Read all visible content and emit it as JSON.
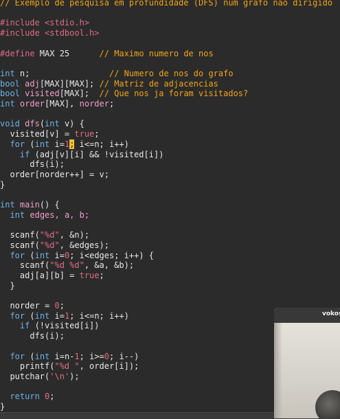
{
  "editor": {
    "lines": [
      [
        {
          "t": "// Exemplo de pesquisa em profundidade (DFS) num grafo nao dirigido",
          "c": "comment"
        }
      ],
      [],
      [
        {
          "t": "#include ",
          "c": "pre"
        },
        {
          "t": "<stdio.h>",
          "c": "inc"
        }
      ],
      [
        {
          "t": "#include ",
          "c": "pre"
        },
        {
          "t": "<stdbool.h>",
          "c": "inc"
        }
      ],
      [],
      [
        {
          "t": "#define ",
          "c": "pre"
        },
        {
          "t": "MAX 25",
          "c": "plain"
        },
        {
          "t": "      ",
          "c": "plain"
        },
        {
          "t": "// Maximo numero de nos",
          "c": "comment"
        }
      ],
      [],
      [
        {
          "t": "int",
          "c": "type"
        },
        {
          "t": " n;",
          "c": "plain"
        },
        {
          "t": "                ",
          "c": "plain"
        },
        {
          "t": "// Numero de nos do grafo",
          "c": "comment"
        }
      ],
      [
        {
          "t": "bool",
          "c": "type"
        },
        {
          "t": " adj",
          "c": "var"
        },
        {
          "t": "[MAX][MAX]; ",
          "c": "plain"
        },
        {
          "t": "// Matriz de adjacencias",
          "c": "comment"
        }
      ],
      [
        {
          "t": "bool",
          "c": "type"
        },
        {
          "t": " visited",
          "c": "var"
        },
        {
          "t": "[MAX];  ",
          "c": "plain"
        },
        {
          "t": "// Que nos ja foram visitados?",
          "c": "comment"
        }
      ],
      [
        {
          "t": "int",
          "c": "type"
        },
        {
          "t": " order",
          "c": "var"
        },
        {
          "t": "[MAX], ",
          "c": "plain"
        },
        {
          "t": "norder",
          "c": "var"
        },
        {
          "t": ";",
          "c": "plain"
        }
      ],
      [],
      [
        {
          "t": "void",
          "c": "type"
        },
        {
          "t": " dfs",
          "c": "fn"
        },
        {
          "t": "(",
          "c": "plain"
        },
        {
          "t": "int",
          "c": "type"
        },
        {
          "t": " v) {",
          "c": "plain"
        }
      ],
      [
        {
          "t": "  visited[v] = ",
          "c": "plain"
        },
        {
          "t": "true",
          "c": "const"
        },
        {
          "t": ";",
          "c": "plain"
        }
      ],
      [
        {
          "t": "  ",
          "c": "plain"
        },
        {
          "t": "for",
          "c": "kw"
        },
        {
          "t": " (",
          "c": "plain"
        },
        {
          "t": "int",
          "c": "type"
        },
        {
          "t": " i=",
          "c": "plain"
        },
        {
          "t": "1",
          "c": "num"
        },
        {
          "t": ";",
          "c": "cursor"
        },
        {
          "t": " i<=n; i++)",
          "c": "plain"
        }
      ],
      [
        {
          "t": "    ",
          "c": "plain"
        },
        {
          "t": "if",
          "c": "kw"
        },
        {
          "t": " (adj[v][i] && !visited[i])",
          "c": "plain"
        }
      ],
      [
        {
          "t": "      dfs(i);",
          "c": "plain"
        }
      ],
      [
        {
          "t": "  order[norder++] = v;",
          "c": "plain"
        }
      ],
      [
        {
          "t": "}",
          "c": "plain"
        }
      ],
      [],
      [
        {
          "t": "int",
          "c": "type"
        },
        {
          "t": " main",
          "c": "fn"
        },
        {
          "t": "() {",
          "c": "plain"
        }
      ],
      [
        {
          "t": "  ",
          "c": "plain"
        },
        {
          "t": "int",
          "c": "type"
        },
        {
          "t": " edges, a, b;",
          "c": "var"
        }
      ],
      [],
      [
        {
          "t": "  scanf(",
          "c": "plain"
        },
        {
          "t": "\"%d\"",
          "c": "str"
        },
        {
          "t": ", &n);",
          "c": "plain"
        }
      ],
      [
        {
          "t": "  scanf(",
          "c": "plain"
        },
        {
          "t": "\"%d\"",
          "c": "str"
        },
        {
          "t": ", &edges);",
          "c": "plain"
        }
      ],
      [
        {
          "t": "  ",
          "c": "plain"
        },
        {
          "t": "for",
          "c": "kw"
        },
        {
          "t": " (",
          "c": "plain"
        },
        {
          "t": "int",
          "c": "type"
        },
        {
          "t": " i=",
          "c": "plain"
        },
        {
          "t": "0",
          "c": "num"
        },
        {
          "t": "; i<edges; i++) {",
          "c": "plain"
        }
      ],
      [
        {
          "t": "    scanf(",
          "c": "plain"
        },
        {
          "t": "\"%d %d\"",
          "c": "str"
        },
        {
          "t": ", &a, &b);",
          "c": "plain"
        }
      ],
      [
        {
          "t": "    adj[a][b] = ",
          "c": "plain"
        },
        {
          "t": "true",
          "c": "const"
        },
        {
          "t": ";",
          "c": "plain"
        }
      ],
      [
        {
          "t": "  }",
          "c": "plain"
        }
      ],
      [],
      [
        {
          "t": "  norder = ",
          "c": "plain"
        },
        {
          "t": "0",
          "c": "num"
        },
        {
          "t": ";",
          "c": "plain"
        }
      ],
      [
        {
          "t": "  ",
          "c": "plain"
        },
        {
          "t": "for",
          "c": "kw"
        },
        {
          "t": " (",
          "c": "plain"
        },
        {
          "t": "int",
          "c": "type"
        },
        {
          "t": " i=",
          "c": "plain"
        },
        {
          "t": "1",
          "c": "num"
        },
        {
          "t": "; i<=n; i++)",
          "c": "plain"
        }
      ],
      [
        {
          "t": "    ",
          "c": "plain"
        },
        {
          "t": "if",
          "c": "kw"
        },
        {
          "t": " (!visited[i])",
          "c": "plain"
        }
      ],
      [
        {
          "t": "      dfs(i);",
          "c": "plain"
        }
      ],
      [],
      [
        {
          "t": "  ",
          "c": "plain"
        },
        {
          "t": "for",
          "c": "kw"
        },
        {
          "t": " (",
          "c": "plain"
        },
        {
          "t": "int",
          "c": "type"
        },
        {
          "t": " i=n-",
          "c": "plain"
        },
        {
          "t": "1",
          "c": "num"
        },
        {
          "t": "; i>=",
          "c": "plain"
        },
        {
          "t": "0",
          "c": "num"
        },
        {
          "t": "; i--)",
          "c": "plain"
        }
      ],
      [
        {
          "t": "    printf(",
          "c": "plain"
        },
        {
          "t": "\"%d \"",
          "c": "str"
        },
        {
          "t": ", order[i]);",
          "c": "plain"
        }
      ],
      [
        {
          "t": "  putchar(",
          "c": "plain"
        },
        {
          "t": "'\\n'",
          "c": "str"
        },
        {
          "t": ");",
          "c": "plain"
        }
      ],
      [],
      [
        {
          "t": "  ",
          "c": "plain"
        },
        {
          "t": "return",
          "c": "kw"
        },
        {
          "t": " ",
          "c": "plain"
        },
        {
          "t": "0",
          "c": "num"
        },
        {
          "t": ";",
          "c": "plain"
        }
      ],
      [
        {
          "t": "}",
          "c": "plain"
        }
      ]
    ]
  },
  "video_window": {
    "title": "vokos"
  },
  "colors": {
    "background": "#2b2b2b",
    "comment": "#f0a41a",
    "keyword": "#6eb1e7",
    "preprocessor": "#df6b88",
    "cursor": "#f2c234"
  }
}
